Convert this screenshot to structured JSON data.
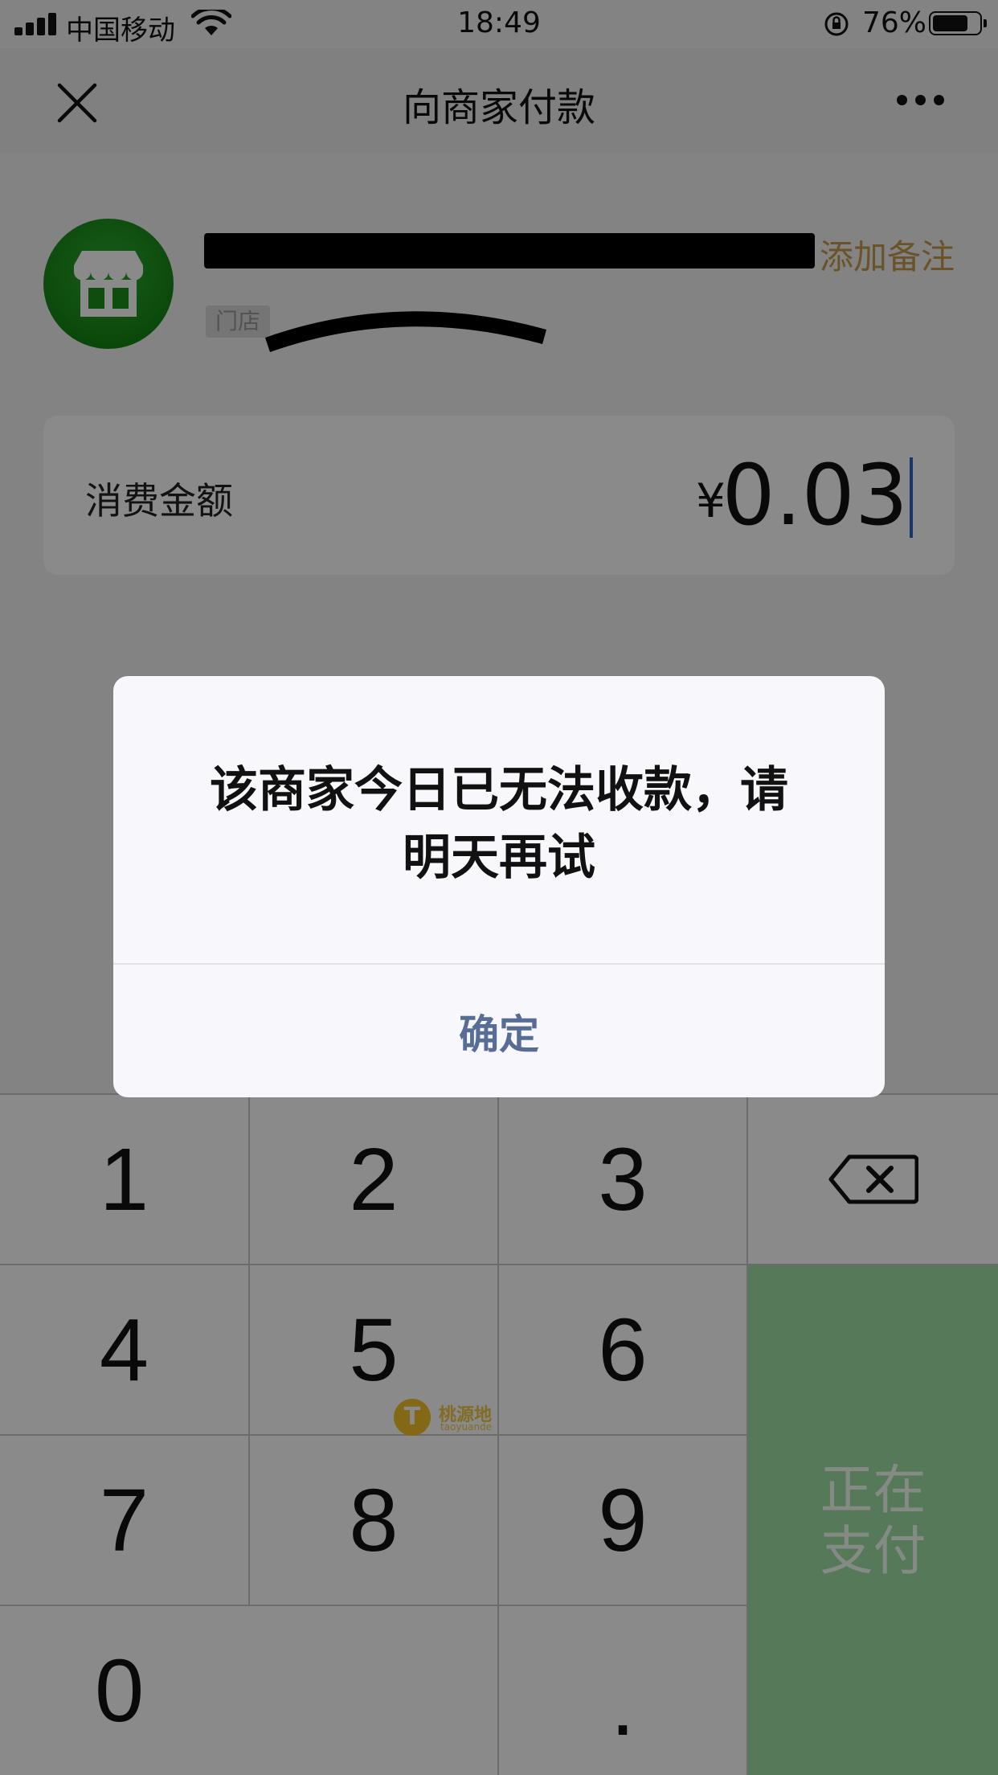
{
  "status_bar": {
    "carrier": "中国移动",
    "time": "18:49",
    "battery_percent": "76%",
    "battery_level": 0.76,
    "icons": [
      "signal-icon",
      "wifi-icon",
      "orientation-lock-icon",
      "battery-icon"
    ]
  },
  "nav": {
    "title": "向商家付款",
    "close_icon": "close-icon",
    "more_icon": "more-icon"
  },
  "merchant": {
    "name": "█████████████",
    "tag": "门店",
    "add_note": "添加备注",
    "logo_icon": "store-icon"
  },
  "amount": {
    "label": "消费金额",
    "currency": "¥",
    "value": "0.03"
  },
  "keypad": {
    "keys": [
      "1",
      "2",
      "3",
      "4",
      "5",
      "6",
      "7",
      "8",
      "9",
      "0",
      "."
    ],
    "pay_label_line1": "正在",
    "pay_label_line2": "支付",
    "pay_color": "#9fe0a5",
    "backspace_icon": "backspace-icon"
  },
  "watermark": {
    "name": "桃源地",
    "sub": "taoyuande",
    "coin_letter": "T"
  },
  "dialog": {
    "message_line1": "该商家今日已无法收款，请",
    "message_line2": "明天再试",
    "confirm": "确定",
    "confirm_color": "#586d96"
  }
}
